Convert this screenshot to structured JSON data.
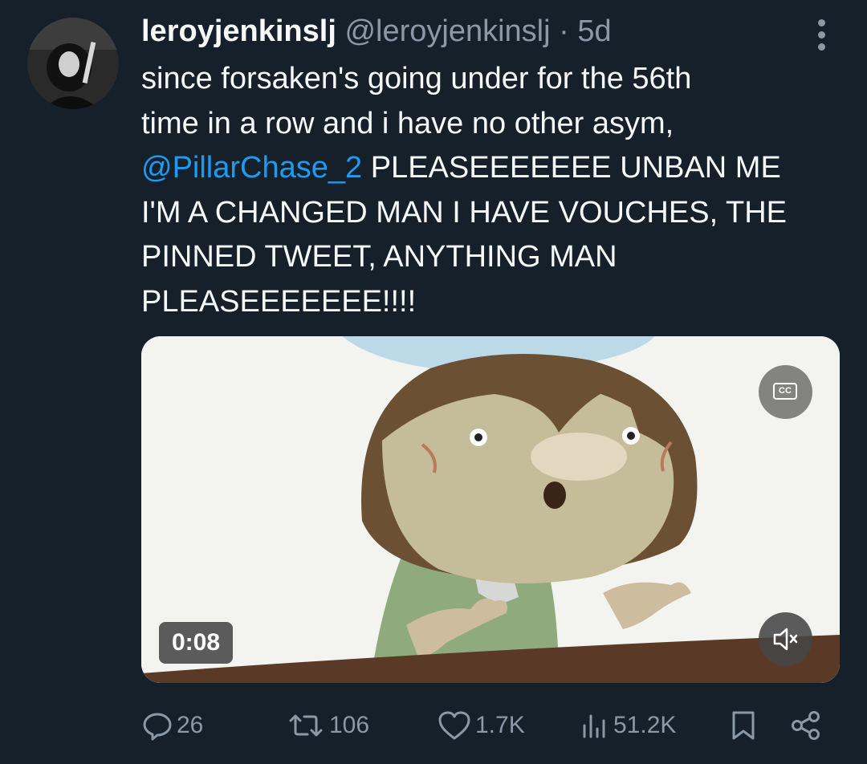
{
  "tweet": {
    "username": "leroyjenkinslj",
    "handle": "@leroyjenkinslj",
    "separator": "·",
    "time": "5d",
    "text_line1": "since forsaken's going under for the 56th",
    "text_line2": "time in a row and i have no other asym,",
    "mention": "@PillarChase_2",
    "text_line3_rest": " PLEASEEEEEEE UNBAN ME",
    "text_line4": "I'M A CHANGED MAN I HAVE VOUCHES, THE",
    "text_line5": "PINNED TWEET, ANYTHING MAN",
    "text_line6": "PLEASEEEEEEE!!!!"
  },
  "media": {
    "type": "video",
    "duration": "0:08",
    "cc_label": "CC",
    "cc_icon": "closed-captions-icon",
    "mute_icon": "speaker-muted-icon"
  },
  "actions": {
    "replies": "26",
    "reposts": "106",
    "likes": "1.7K",
    "views": "51.2K",
    "icons": [
      "reply-icon",
      "repost-icon",
      "like-icon",
      "views-icon",
      "bookmark-icon",
      "share-icon"
    ]
  },
  "colors": {
    "background": "#15202b",
    "text": "#f7f9f9",
    "secondary": "#8b98a5",
    "accent": "#1d9bf0"
  }
}
